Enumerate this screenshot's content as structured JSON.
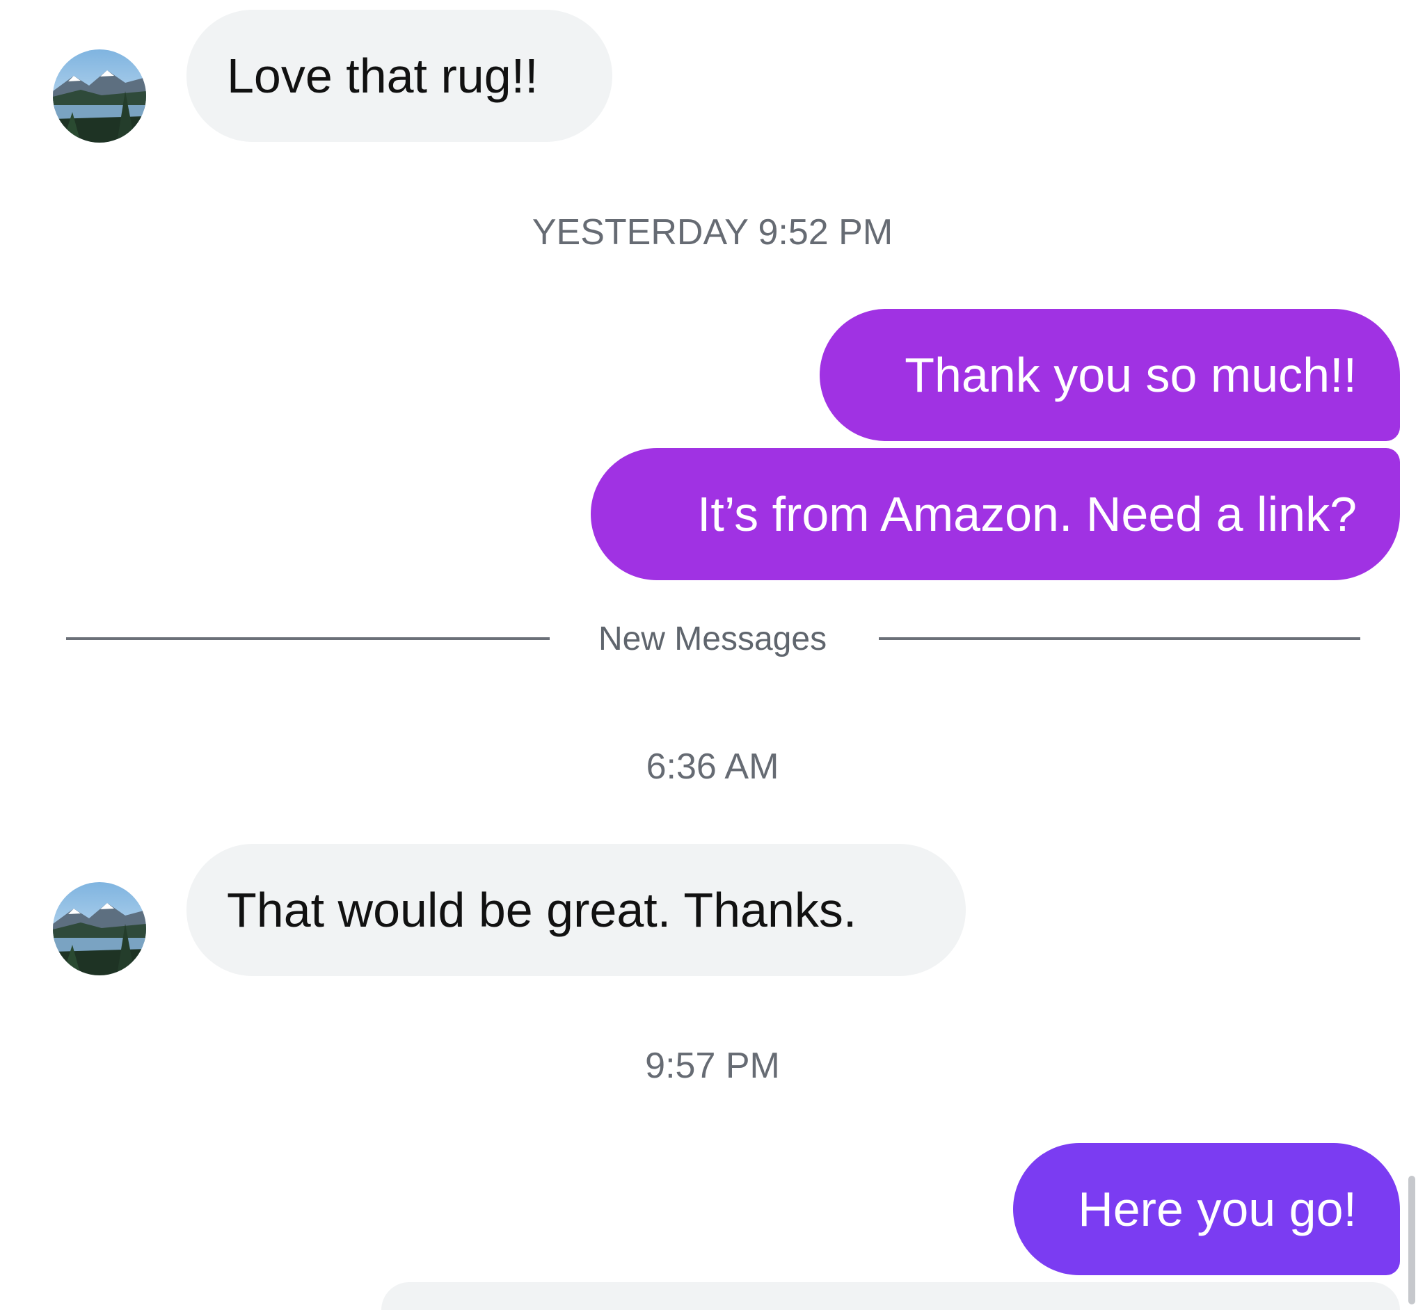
{
  "conversation": {
    "timestamps": {
      "first": "YESTERDAY 9:52 PM",
      "second": "6:36 AM",
      "third": "9:57 PM"
    },
    "divider_label": "New Messages",
    "messages": [
      {
        "direction": "incoming",
        "text": "Love that rug!!"
      },
      {
        "direction": "outgoing",
        "text": "Thank you so much!!"
      },
      {
        "direction": "outgoing",
        "text": "It’s from Amazon. Need a link?"
      },
      {
        "direction": "incoming",
        "text": "That would be great. Thanks."
      },
      {
        "direction": "outgoing",
        "text": "Here you go!"
      }
    ],
    "contact_avatar": "mountain-lake-photo",
    "colors": {
      "outgoing_primary": "#a032e3",
      "outgoing_latest": "#7b3cf2",
      "incoming_bubble": "#f1f3f4",
      "timestamp_text": "#666b73"
    }
  }
}
